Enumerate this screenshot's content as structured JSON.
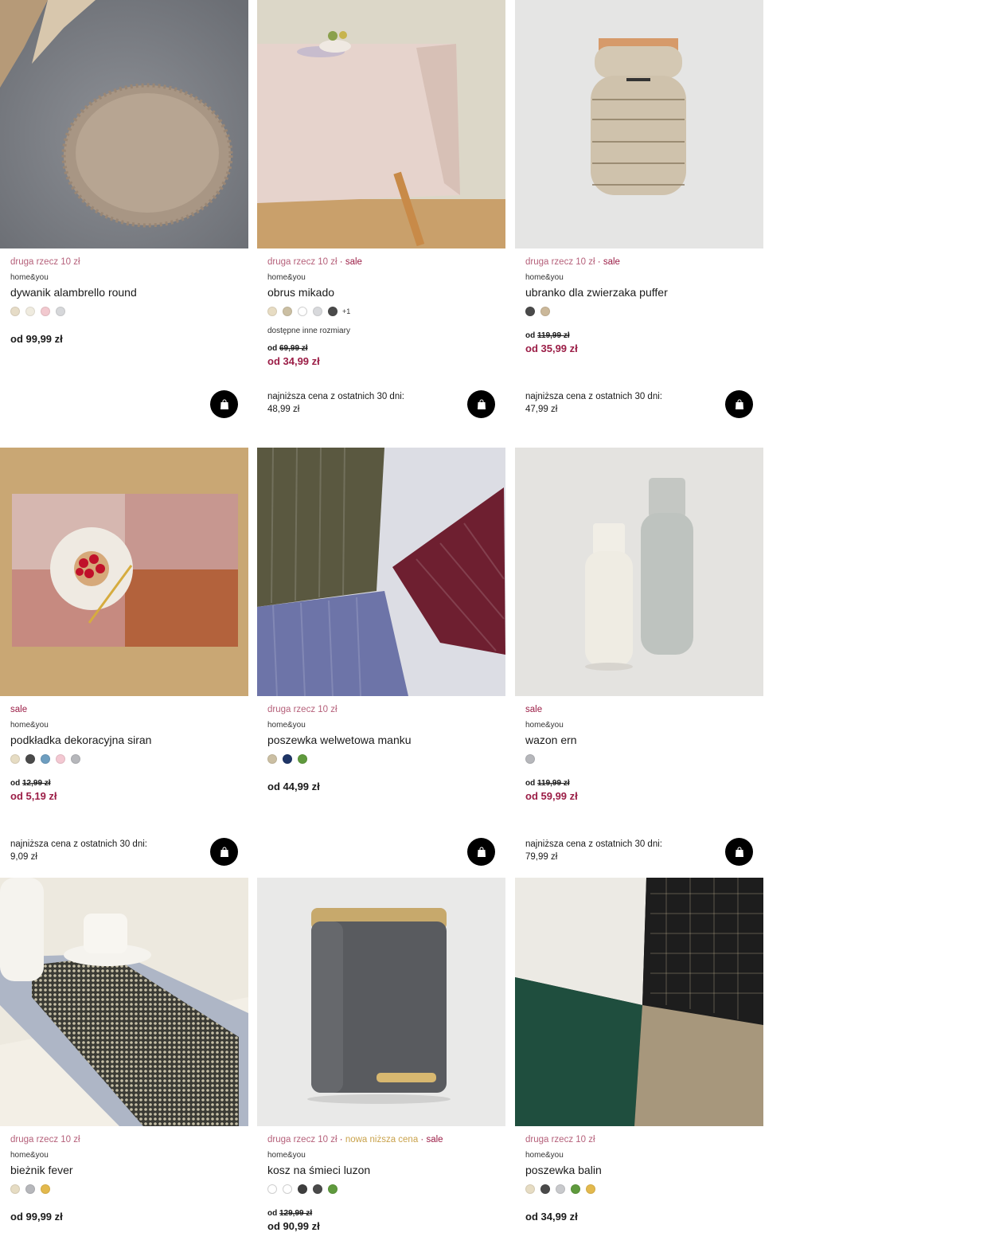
{
  "products": [
    {
      "tags": [
        {
          "text": "druga rzecz 10 zł",
          "kind": "promo"
        }
      ],
      "brand": "home&you",
      "name": "dywanik alambrello round",
      "swatches": [
        "#e6dcc7",
        "#efebdf",
        "#f2c9cf",
        "#d6d7da"
      ],
      "more_colors": "",
      "sizes_note": "",
      "old_price_prefix": "",
      "old_price": "",
      "price": "od 99,99 zł",
      "price_is_sale": false,
      "lowest_price_label": "",
      "lowest_price_value": "",
      "image_icon": "round-rug-image"
    },
    {
      "tags": [
        {
          "text": "druga rzecz 10 zł",
          "kind": "promo"
        },
        {
          "text": "sale",
          "kind": "sale"
        }
      ],
      "brand": "home&you",
      "name": "obrus mikado",
      "swatches": [
        "#e7dcc3",
        "#cbbfa3",
        "#ffffff",
        "#d8d9dc",
        "#4a4a4a"
      ],
      "more_colors": "+1",
      "sizes_note": "dostępne inne rozmiary",
      "old_price_prefix": "od",
      "old_price": "69,99 zł",
      "price": "od 34,99 zł",
      "price_is_sale": true,
      "lowest_price_label": "najniższa cena z ostatnich 30 dni:",
      "lowest_price_value": "48,99 zł",
      "image_icon": "tablecloth-image"
    },
    {
      "tags": [
        {
          "text": "druga rzecz 10 zł",
          "kind": "promo"
        },
        {
          "text": "sale",
          "kind": "sale"
        }
      ],
      "brand": "home&you",
      "name": "ubranko dla zwierzaka puffer",
      "swatches": [
        "#4a4a4a",
        "#cbb89a"
      ],
      "more_colors": "",
      "sizes_note": "",
      "old_price_prefix": "od",
      "old_price": "119,99 zł",
      "price": "od 35,99 zł",
      "price_is_sale": true,
      "lowest_price_label": "najniższa cena z ostatnich 30 dni:",
      "lowest_price_value": "47,99 zł",
      "image_icon": "pet-jacket-image"
    },
    {
      "tags": [
        {
          "text": "sale",
          "kind": "sale"
        }
      ],
      "brand": "home&you",
      "name": "podkładka dekoracyjna siran",
      "swatches": [
        "#e6dcc3",
        "#4a4a4a",
        "#6e9ec0",
        "#f3c8d2",
        "#b6b7bb"
      ],
      "more_colors": "",
      "sizes_note": "",
      "old_price_prefix": "od",
      "old_price": "12,99 zł",
      "price": "od 5,19 zł",
      "price_is_sale": true,
      "lowest_price_label": "najniższa cena z ostatnich 30 dni:",
      "lowest_price_value": "9,09 zł",
      "image_icon": "placemat-image"
    },
    {
      "tags": [
        {
          "text": "druga rzecz 10 zł",
          "kind": "promo"
        }
      ],
      "brand": "home&you",
      "name": "poszewka welwetowa manku",
      "swatches": [
        "#cbbfa3",
        "#1e3566",
        "#5f9a3d"
      ],
      "more_colors": "",
      "sizes_note": "",
      "old_price_prefix": "",
      "old_price": "",
      "price": "od 44,99 zł",
      "price_is_sale": false,
      "lowest_price_label": "",
      "lowest_price_value": "",
      "image_icon": "velvet-pillows-image"
    },
    {
      "tags": [
        {
          "text": "sale",
          "kind": "sale"
        }
      ],
      "brand": "home&you",
      "name": "wazon ern",
      "swatches": [
        "#b6b7bb"
      ],
      "more_colors": "",
      "sizes_note": "",
      "old_price_prefix": "od",
      "old_price": "119,99 zł",
      "price": "od 59,99 zł",
      "price_is_sale": true,
      "lowest_price_label": "najniższa cena z ostatnich 30 dni:",
      "lowest_price_value": "79,99 zł",
      "image_icon": "vases-image"
    },
    {
      "tags": [
        {
          "text": "druga rzecz 10 zł",
          "kind": "promo"
        }
      ],
      "brand": "home&you",
      "name": "bieżnik fever",
      "swatches": [
        "#e6dcc3",
        "#b6b7bb",
        "#e3b94d"
      ],
      "more_colors": "",
      "sizes_note": "",
      "old_price_prefix": "",
      "old_price": "",
      "price": "od 99,99 zł",
      "price_is_sale": false,
      "lowest_price_label": "",
      "lowest_price_value": "",
      "image_icon": "table-runner-image"
    },
    {
      "tags": [
        {
          "text": "druga rzecz 10 zł",
          "kind": "promo"
        },
        {
          "text": "nowa niższa cena",
          "kind": "new"
        },
        {
          "text": "sale",
          "kind": "sale"
        }
      ],
      "brand": "home&you",
      "name": "kosz na śmieci luzon",
      "swatches": [
        "#ffffff",
        "#ffffff",
        "#3e3e3e",
        "#4a4a4a",
        "#5f9a3d"
      ],
      "more_colors": "",
      "sizes_note": "",
      "old_price_prefix": "od",
      "old_price": "129,99 zł",
      "price": "od 90,99 zł",
      "price_is_sale": false,
      "lowest_price_label": "",
      "lowest_price_value": "",
      "image_icon": "trash-bin-image"
    },
    {
      "tags": [
        {
          "text": "druga rzecz 10 zł",
          "kind": "promo"
        }
      ],
      "brand": "home&you",
      "name": "poszewka balin",
      "swatches": [
        "#e6dcc3",
        "#4a4a4a",
        "#c8c9cc",
        "#5f9a3d",
        "#e3b94d"
      ],
      "more_colors": "",
      "sizes_note": "",
      "old_price_prefix": "",
      "old_price": "",
      "price": "od 34,99 zł",
      "price_is_sale": false,
      "lowest_price_label": "",
      "lowest_price_value": "",
      "image_icon": "woven-pillows-image"
    }
  ],
  "colors": {
    "promo": "#b5607a",
    "sale": "#9b1d46",
    "new_lower_price": "#c9a24b",
    "cart_button": "#000000"
  },
  "cart_button_icon": "shopping-bag-icon"
}
